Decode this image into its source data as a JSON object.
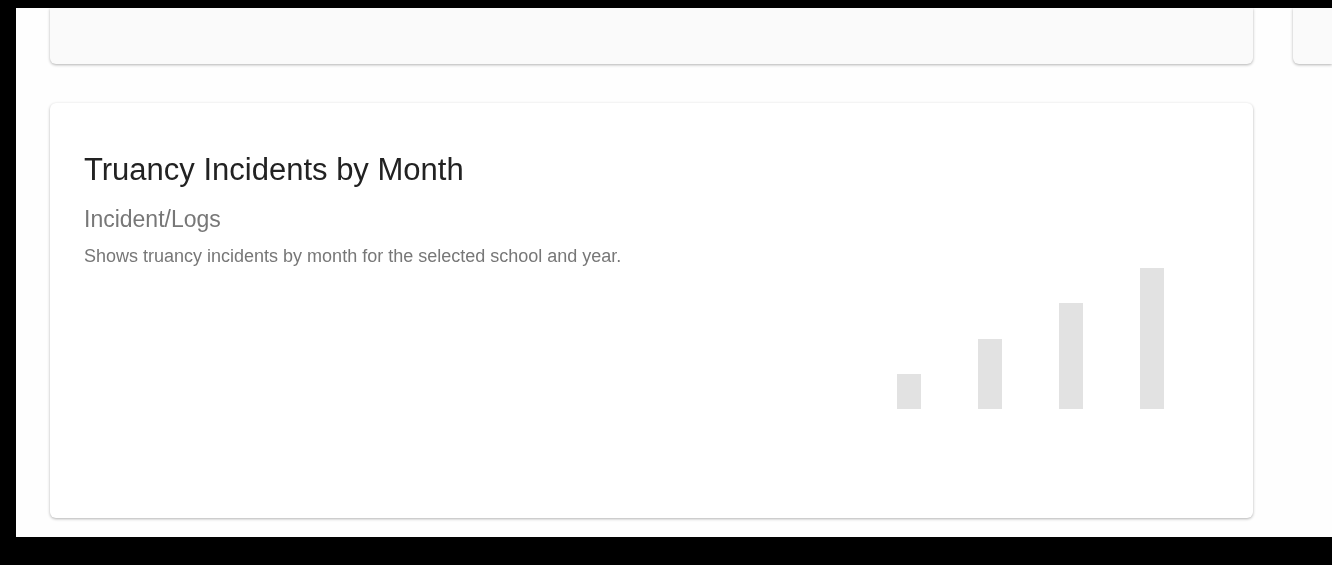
{
  "report_card": {
    "title": "Truancy Incidents by Month",
    "category": "Incident/Logs",
    "description": "Shows truancy incidents by month for the selected school and year."
  }
}
